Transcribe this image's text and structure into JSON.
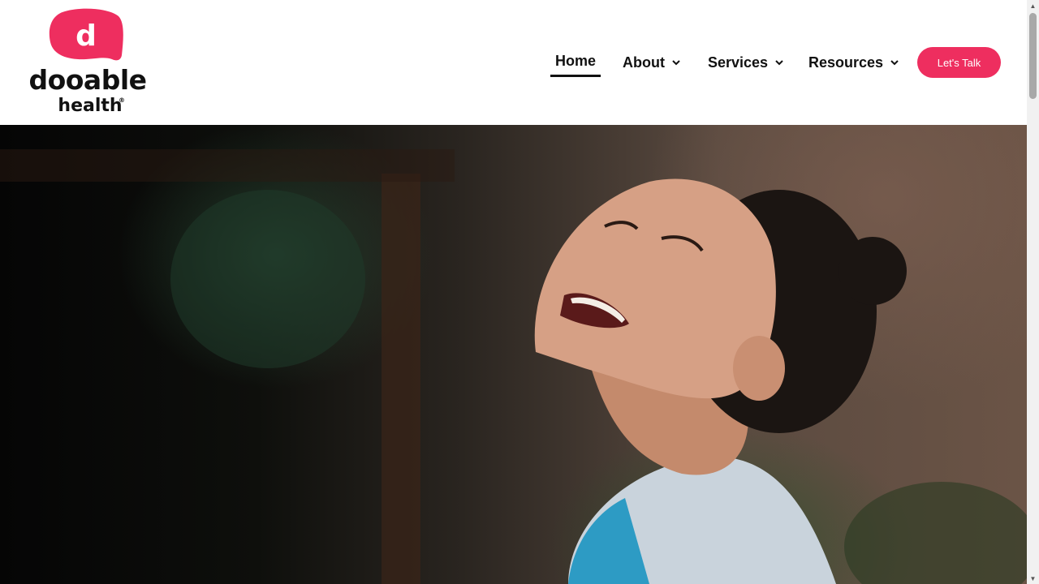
{
  "logo": {
    "bubble_letter": "d",
    "wordmark": "dooable",
    "subtext": "health",
    "registered": "®",
    "brand_color": "#ee2e5f"
  },
  "nav": {
    "items": [
      {
        "label": "Home",
        "active": true,
        "has_dropdown": false
      },
      {
        "label": "About",
        "active": false,
        "has_dropdown": true
      },
      {
        "label": "Services",
        "active": false,
        "has_dropdown": true
      },
      {
        "label": "Resources",
        "active": false,
        "has_dropdown": true
      }
    ],
    "cta_label": "Let's Talk",
    "cta_color": "#ee2e5f",
    "dropdown_icon": "chevron-down-icon"
  },
  "hero": {
    "image": "photo of a laughing woman with head tilted back, outdoors"
  },
  "scrollbar": {
    "up_icon": "triangle-up-icon",
    "down_icon": "triangle-down-icon"
  }
}
